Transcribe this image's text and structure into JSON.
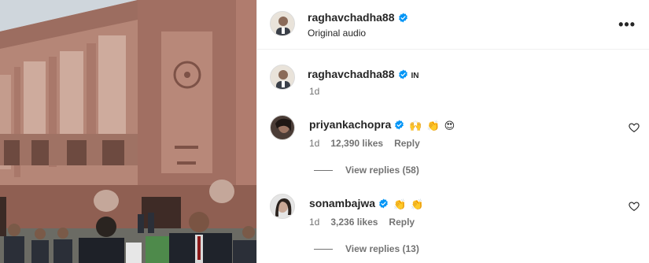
{
  "post": {
    "author": "raghavchadha88",
    "audio": "Original audio",
    "more_icon": "more-horizontal-icon"
  },
  "caption": {
    "author": "raghavchadha88",
    "country": "IN",
    "time": "1d"
  },
  "comments": [
    {
      "author": "priyankachopra",
      "emojis": [
        "🙌",
        "👏",
        "😍"
      ],
      "time": "1d",
      "likes": "12,390 likes",
      "reply": "Reply",
      "view_replies": "View replies (58)"
    },
    {
      "author": "sonambajwa",
      "emojis": [
        "👏",
        "👏"
      ],
      "time": "1d",
      "likes": "3,236 likes",
      "reply": "Reply",
      "view_replies": "View replies (13)"
    }
  ],
  "colors": {
    "verified": "#0095f6",
    "text": "#262626",
    "secondary": "#737373",
    "divider": "#efefef"
  }
}
